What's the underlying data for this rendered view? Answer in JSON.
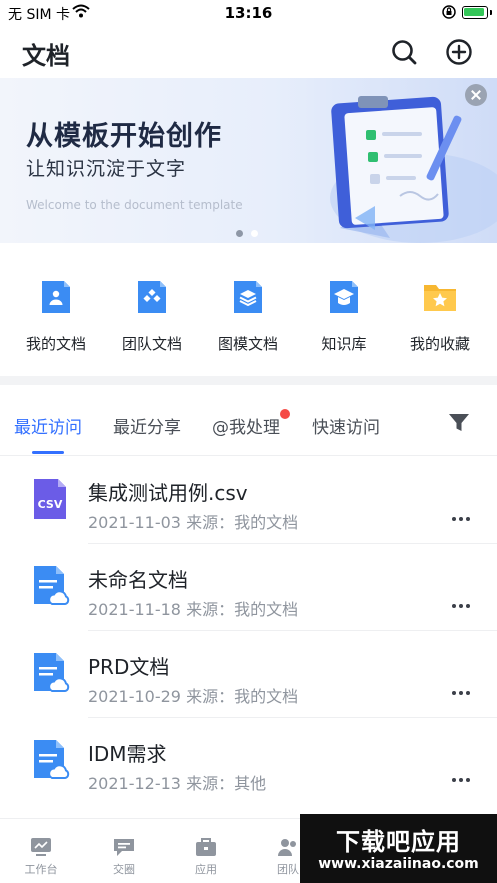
{
  "status_bar": {
    "carrier": "无 SIM 卡",
    "time": "13:16"
  },
  "header": {
    "title": "文档"
  },
  "banner": {
    "title": "从模板开始创作",
    "subtitle": "让知识沉淀于文字",
    "caption": "Welcome to the document template"
  },
  "quick_entries": [
    {
      "label": "我的文档",
      "icon": "my-docs-icon"
    },
    {
      "label": "团队文档",
      "icon": "team-docs-icon"
    },
    {
      "label": "图模文档",
      "icon": "template-docs-icon"
    },
    {
      "label": "知识库",
      "icon": "knowledge-base-icon"
    },
    {
      "label": "我的收藏",
      "icon": "favorites-icon"
    }
  ],
  "tabs": [
    {
      "label": "最近访问",
      "active": true
    },
    {
      "label": "最近分享",
      "active": false
    },
    {
      "label": "@我处理",
      "active": false,
      "has_notification": true
    },
    {
      "label": "快速访问",
      "active": false
    }
  ],
  "files": [
    {
      "name": "集成测试用例.csv",
      "meta": "2021-11-03 来源：我的文档",
      "icon": "csv-file-icon",
      "icon_text": "CSV"
    },
    {
      "name": "未命名文档",
      "meta": "2021-11-18 来源：我的文档",
      "icon": "cloud-doc-icon"
    },
    {
      "name": "PRD文档",
      "meta": "2021-10-29 来源：我的文档",
      "icon": "cloud-doc-icon"
    },
    {
      "name": "IDM需求",
      "meta": "2021-12-13 来源：其他",
      "icon": "cloud-doc-icon"
    }
  ],
  "bottom_nav": [
    {
      "label": "工作台",
      "icon": "workbench-icon"
    },
    {
      "label": "交圈",
      "icon": "chat-icon"
    },
    {
      "label": "应用",
      "icon": "apps-icon"
    },
    {
      "label": "团队",
      "icon": "team-icon"
    }
  ],
  "watermark": {
    "main": "下载吧应用",
    "sub": "www.xiazaiinao.com"
  },
  "colors": {
    "accent": "#3370ff",
    "notification": "#f54a45",
    "muted": "#8f959e"
  }
}
